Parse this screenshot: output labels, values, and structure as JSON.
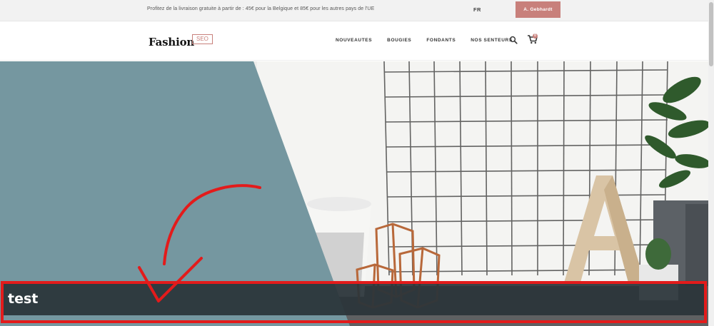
{
  "topbar": {
    "promo": "Profitez de la livraison gratuite à partir de : 45€ pour la Belgique et 85€ pour les autres pays de l'UE",
    "language": "FR",
    "account_label": "A. Gebhardt"
  },
  "header": {
    "logo_main": "Fashion",
    "logo_badge": "SEO",
    "nav": [
      {
        "label": "NOUVEAUTES"
      },
      {
        "label": "BOUGIES"
      },
      {
        "label": "FONDANTS"
      },
      {
        "label": "NOS SENTEURS"
      }
    ],
    "icons": {
      "search": "search-icon",
      "cart": "cart-icon"
    },
    "cart_count": "0"
  },
  "hero": {
    "caption": "test",
    "colors": {
      "teal_panel": "#7597a0",
      "caption_bg": "#2a3439",
      "annotation": "#e31b1b"
    }
  },
  "colors": {
    "accent": "#c8807b",
    "topbar_bg": "#f2f2f2"
  }
}
